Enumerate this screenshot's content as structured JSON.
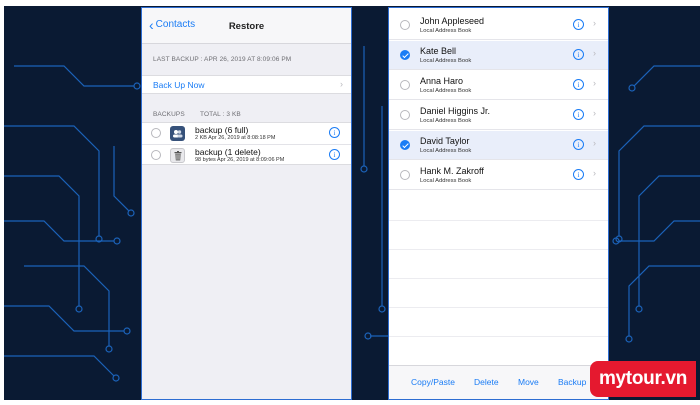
{
  "colors": {
    "accent": "#1a7cf5",
    "background": "#0a1a33",
    "selected_row": "#e9eefa",
    "watermark": "#e5192f"
  },
  "restore_screen": {
    "back_label": "Contacts",
    "title": "Restore",
    "last_backup_label": "LAST BACKUP : APR 26, 2019 AT 8:09:06 PM",
    "backup_now_label": "Back Up Now",
    "backups_header": "BACKUPS",
    "total_header": "TOTAL : 3 KB",
    "backups": [
      {
        "name": "backup (6 full)",
        "meta": "2 KB  Apr 26, 2019 at 8:08:18 PM",
        "icon": "contacts-icon"
      },
      {
        "name": "backup (1 delete)",
        "meta": "98 bytes  Apr 26, 2019 at 8:09:06 PM",
        "icon": "trash-icon"
      }
    ]
  },
  "contacts_screen": {
    "contacts": [
      {
        "name": "John Appleseed",
        "source": "Local Address Book",
        "selected": false
      },
      {
        "name": "Kate Bell",
        "source": "Local Address Book",
        "selected": true
      },
      {
        "name": "Anna Haro",
        "source": "Local Address Book",
        "selected": false
      },
      {
        "name": "Daniel Higgins Jr.",
        "source": "Local Address Book",
        "selected": false
      },
      {
        "name": "David Taylor",
        "source": "Local Address Book",
        "selected": true
      },
      {
        "name": "Hank M. Zakroff",
        "source": "Local Address Book",
        "selected": false
      }
    ],
    "toolbar": {
      "copy_paste": "Copy/Paste",
      "delete": "Delete",
      "move": "Move",
      "backup": "Backup"
    }
  },
  "icons": {
    "info": "i",
    "chevron": "›",
    "back": "‹"
  },
  "watermark": {
    "text": "mytour.vn"
  }
}
